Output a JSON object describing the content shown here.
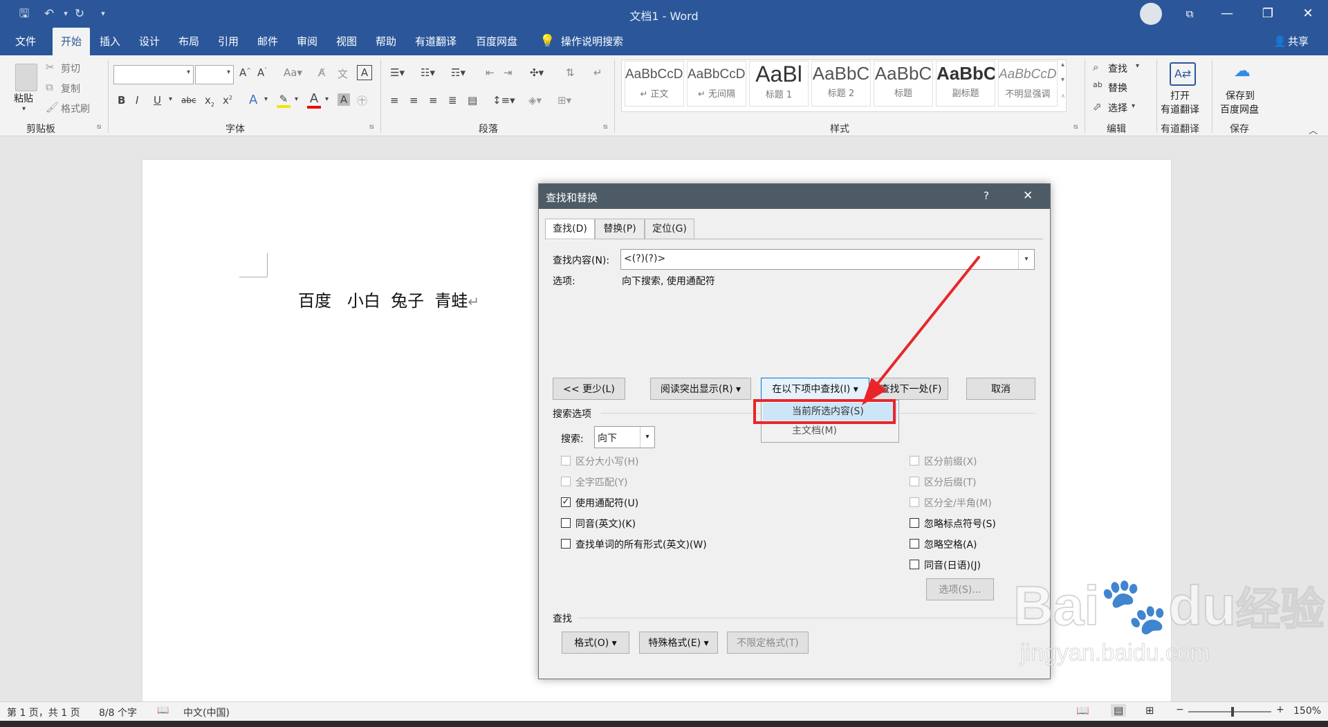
{
  "window": {
    "title": "文档1  -  Word"
  },
  "menubar": {
    "tabs": [
      "文件",
      "开始",
      "插入",
      "设计",
      "布局",
      "引用",
      "邮件",
      "审阅",
      "视图",
      "帮助",
      "有道翻译",
      "百度网盘"
    ],
    "tell_me": "操作说明搜索",
    "share": "共享"
  },
  "ribbon": {
    "clipboard": {
      "paste": "粘贴",
      "cut": "剪切",
      "copy": "复制",
      "format_painter": "格式刷",
      "label": "剪贴板"
    },
    "font": {
      "label": "字体",
      "font_name": "",
      "font_size": ""
    },
    "paragraph": {
      "label": "段落"
    },
    "styles": {
      "label": "样式",
      "items": [
        {
          "sample": "AaBbCcDc",
          "name": "↵ 正文"
        },
        {
          "sample": "AaBbCcDc",
          "name": "↵ 无间隔"
        },
        {
          "sample": "AaBl",
          "name": "标题 1"
        },
        {
          "sample": "AaBbC",
          "name": "标题 2"
        },
        {
          "sample": "AaBbC",
          "name": "标题"
        },
        {
          "sample": "AaBbC",
          "name": "副标题"
        },
        {
          "sample": "AaBbCcDc",
          "name": "不明显强调"
        }
      ]
    },
    "editing": {
      "find": "查找",
      "replace": "替换",
      "select": "选择",
      "label": "编辑"
    },
    "youdao": {
      "open_line1": "打开",
      "open_line2": "有道翻译",
      "label": "有道翻译"
    },
    "baidu": {
      "save_line1": "保存到",
      "save_line2": "百度网盘",
      "label": "保存"
    }
  },
  "document": {
    "text": "百度   小白  兔子  青蛙",
    "para_mark": "↵"
  },
  "dialog": {
    "title": "查找和替换",
    "help": "?",
    "close": "✕",
    "tabs": [
      "查找(D)",
      "替换(P)",
      "定位(G)"
    ],
    "find_label": "查找内容(N):",
    "find_value": "<(?)(?)>",
    "options_label": "选项:",
    "options_value": "向下搜索, 使用通配符",
    "buttons": {
      "less": "<< 更少(L)",
      "reading_highlight": "阅读突出显示(R) ▾",
      "find_in": "在以下项中查找(I) ▾",
      "find_next": "查找下一处(F)",
      "cancel": "取消"
    },
    "find_in_menu": [
      "当前所选内容(S)",
      "主文档(M)"
    ],
    "search_options_label": "搜索选项",
    "search_label": "搜索:",
    "search_value": "向下",
    "checkboxes_left": [
      {
        "label": "区分大小写(H)",
        "checked": false,
        "enabled": false
      },
      {
        "label": "全字匹配(Y)",
        "checked": false,
        "enabled": false
      },
      {
        "label": "使用通配符(U)",
        "checked": true,
        "enabled": true
      },
      {
        "label": "同音(英文)(K)",
        "checked": false,
        "enabled": true
      },
      {
        "label": "查找单词的所有形式(英文)(W)",
        "checked": false,
        "enabled": true
      }
    ],
    "checkboxes_right": [
      {
        "label": "区分前缀(X)",
        "checked": false,
        "enabled": false
      },
      {
        "label": "区分后缀(T)",
        "checked": false,
        "enabled": false
      },
      {
        "label": "区分全/半角(M)",
        "checked": false,
        "enabled": false
      },
      {
        "label": "忽略标点符号(S)",
        "checked": false,
        "enabled": true
      },
      {
        "label": "忽略空格(A)",
        "checked": false,
        "enabled": true
      },
      {
        "label": "同音(日语)(J)",
        "checked": false,
        "enabled": true
      }
    ],
    "options_button": "选项(S)...",
    "find_section_label": "查找",
    "format_button": "格式(O) ▾",
    "special_button": "特殊格式(E) ▾",
    "no_format_button": "不限定格式(T)"
  },
  "statusbar": {
    "page": "第 1 页，共 1 页",
    "words": "8/8 个字",
    "language": "中文(中国)",
    "zoom": "150%"
  },
  "watermark": {
    "brand": "Bai",
    "brand2": "du",
    "brand_cn": "经验",
    "url": "jingyan.baidu.com"
  },
  "colors": {
    "word_blue": "#2b579a",
    "highlight_red": "#e8262a",
    "dialog_title": "#4d5b66"
  }
}
